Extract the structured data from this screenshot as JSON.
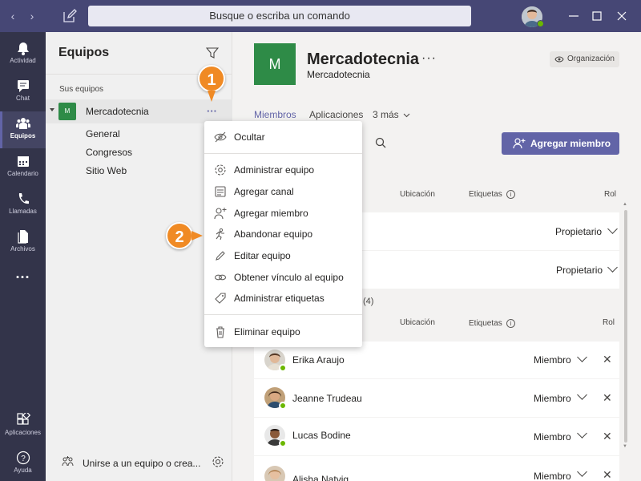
{
  "titlebar": {
    "search_placeholder": "Busque o escriba un comando",
    "colors": {
      "bar": "#464775"
    }
  },
  "appbar": {
    "items": [
      {
        "label": "Actividad",
        "icon": "bell-icon"
      },
      {
        "label": "Chat",
        "icon": "chat-icon"
      },
      {
        "label": "Equipos",
        "icon": "teams-icon",
        "active": true
      },
      {
        "label": "Calendario",
        "icon": "calendar-icon"
      },
      {
        "label": "Llamadas",
        "icon": "phone-icon"
      },
      {
        "label": "Archivos",
        "icon": "file-icon"
      },
      {
        "label": "...",
        "icon": "more-icon"
      },
      {
        "label": "Aplicaciones",
        "icon": "apps-icon"
      },
      {
        "label": "Ayuda",
        "icon": "help-icon"
      }
    ]
  },
  "teams_panel": {
    "title": "Equipos",
    "section_label": "Sus equipos",
    "team": {
      "tile_initial": "M",
      "name": "Mercadotecnia"
    },
    "channels": [
      "General",
      "Congresos",
      "Sitio Web"
    ],
    "join_text": "Unirse a un equipo o crea..."
  },
  "main": {
    "tile_initial": "M",
    "title": "Mercadotecnia",
    "title_dots": "···",
    "subtitle": "Mercadotecnia",
    "org_label": "Organización",
    "tabs": [
      "Miembros",
      "Aplicaciones",
      "3 más"
    ],
    "add_member_label": "Agregar miembro",
    "columns": {
      "location": "Ubicación",
      "tags": "Etiquetas",
      "role": "Rol"
    },
    "owners": [
      {
        "role": "Propietario"
      },
      {
        "role": "Propietario"
      }
    ],
    "members_count_suffix": "(4)",
    "members": [
      {
        "name": "Erika Araujo",
        "role": "Miembro"
      },
      {
        "name": "Jeanne Trudeau",
        "role": "Miembro"
      },
      {
        "name": "Lucas Bodine",
        "role": "Miembro"
      },
      {
        "name": "Alisha Natvig",
        "role": "Miembro"
      }
    ]
  },
  "context_menu": {
    "items": [
      {
        "label": "Ocultar",
        "icon": "eye-slash-icon"
      },
      {
        "label": "Administrar equipo",
        "icon": "gear-icon"
      },
      {
        "label": "Agregar canal",
        "icon": "channel-icon"
      },
      {
        "label": "Agregar miembro",
        "icon": "add-person-icon"
      },
      {
        "label": "Abandonar equipo",
        "icon": "leave-icon"
      },
      {
        "label": "Editar equipo",
        "icon": "pencil-icon"
      },
      {
        "label": "Obtener vínculo al equipo",
        "icon": "link-icon"
      },
      {
        "label": "Administrar etiquetas",
        "icon": "tag-icon"
      },
      {
        "label": "Eliminar equipo",
        "icon": "trash-icon"
      }
    ]
  },
  "callouts": [
    "1",
    "2"
  ],
  "colors": {
    "accent": "#6264a7",
    "team_tile": "#2e8b47",
    "callout": "#f08a24",
    "presence": "#6bb700"
  }
}
